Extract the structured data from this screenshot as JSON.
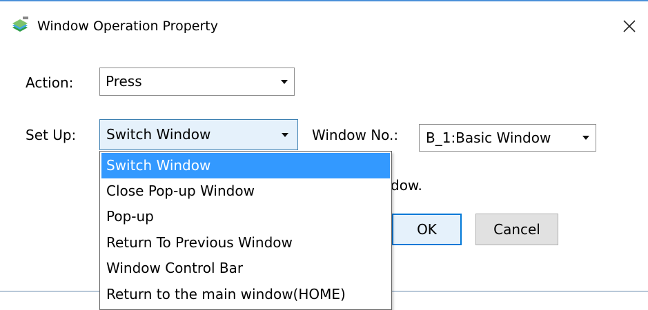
{
  "window": {
    "title": "Window Operation Property",
    "icon": "app-icon",
    "close_icon": "close-icon"
  },
  "form": {
    "action_label": "Action:",
    "action_value": "Press",
    "setup_label": "Set Up:",
    "setup_value": "Switch Window",
    "window_no_label": "Window No.:",
    "window_no_value": "B_1:Basic Window",
    "hint_fragment": "dow."
  },
  "dropdown": {
    "items": [
      {
        "label": "Switch Window",
        "selected": true
      },
      {
        "label": "Close Pop-up Window",
        "selected": false
      },
      {
        "label": "Pop-up",
        "selected": false
      },
      {
        "label": "Return To Previous Window",
        "selected": false
      },
      {
        "label": "Window Control Bar",
        "selected": false
      },
      {
        "label": "Return to the main window(HOME)",
        "selected": false
      }
    ]
  },
  "buttons": {
    "ok": "OK",
    "cancel": "Cancel"
  },
  "colors": {
    "accent": "#0078d7",
    "selection": "#3399ff",
    "title_border": "#4a90d9"
  }
}
